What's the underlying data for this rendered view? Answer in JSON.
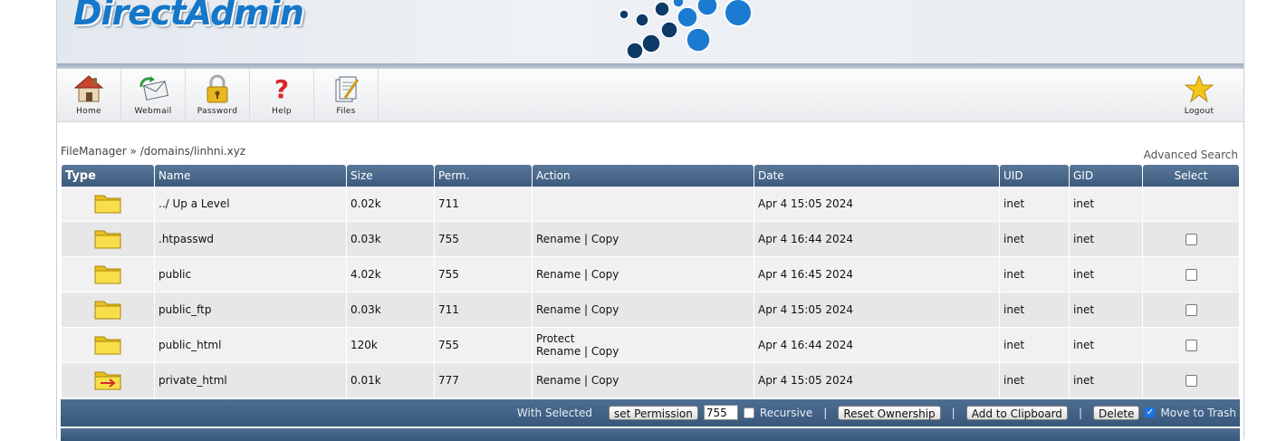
{
  "brand": {
    "logo_text": "DirectAdmin"
  },
  "toolbar": {
    "items": [
      {
        "label": "Home",
        "icon": "home-icon"
      },
      {
        "label": "Webmail",
        "icon": "webmail-icon"
      },
      {
        "label": "Password",
        "icon": "lock-icon"
      },
      {
        "label": "Help",
        "icon": "help-icon"
      },
      {
        "label": "Files",
        "icon": "files-icon"
      }
    ],
    "logout": {
      "label": "Logout",
      "icon": "star-icon"
    }
  },
  "breadcrumb": {
    "root": "FileManager",
    "separator": "»",
    "path": "/domains/linhni.xyz"
  },
  "advanced_search": "Advanced Search",
  "table": {
    "headers": [
      "Type",
      "Name",
      "Size",
      "Perm.",
      "Action",
      "Date",
      "UID",
      "GID",
      "Select"
    ],
    "rows": [
      {
        "icon": "folder-icon",
        "name": "../ Up a Level",
        "size": "0.02k",
        "perm": "711",
        "action1": "",
        "action2": "",
        "date": "Apr 4 15:05 2024",
        "uid": "inet",
        "gid": "inet",
        "selectable": false
      },
      {
        "icon": "folder-icon",
        "name": ".htpasswd",
        "size": "0.03k",
        "perm": "755",
        "action1": "",
        "action2": "Rename | Copy",
        "date": "Apr 4 16:44 2024",
        "uid": "inet",
        "gid": "inet",
        "selectable": true
      },
      {
        "icon": "folder-icon",
        "name": "public",
        "size": "4.02k",
        "perm": "755",
        "action1": "",
        "action2": "Rename | Copy",
        "date": "Apr 4 16:45 2024",
        "uid": "inet",
        "gid": "inet",
        "selectable": true
      },
      {
        "icon": "folder-icon",
        "name": "public_ftp",
        "size": "0.03k",
        "perm": "711",
        "action1": "",
        "action2": "Rename | Copy",
        "date": "Apr 4 15:05 2024",
        "uid": "inet",
        "gid": "inet",
        "selectable": true
      },
      {
        "icon": "folder-icon",
        "name": "public_html",
        "size": "120k",
        "perm": "755",
        "action1": "Protect",
        "action2": "Rename | Copy",
        "date": "Apr 4 16:44 2024",
        "uid": "inet",
        "gid": "inet",
        "selectable": true
      },
      {
        "icon": "folder-link-icon",
        "name": "private_html",
        "size": "0.01k",
        "perm": "777",
        "action1": "",
        "action2": "Rename | Copy",
        "date": "Apr 4 15:05 2024",
        "uid": "inet",
        "gid": "inet",
        "selectable": true
      }
    ]
  },
  "bottom": {
    "with_selected": "With Selected",
    "set_permission": "set Permission",
    "permission_value": "755",
    "recursive": "Recursive",
    "reset_ownership": "Reset Ownership",
    "add_to_clipboard": "Add to Clipboard",
    "delete": "Delete",
    "move_to_trash": "Move to Trash",
    "pipe": "|"
  },
  "colors": {
    "header_blue": "#3c5a7d",
    "logo_blue": "#1477c9",
    "dot_dark": "#0d3a66",
    "dot_light": "#1a7bd1"
  }
}
